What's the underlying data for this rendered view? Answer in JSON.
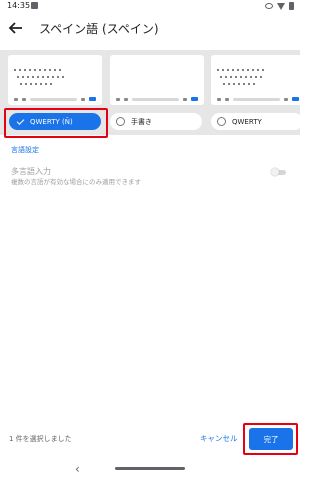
{
  "status_bar": {
    "time": "14:35",
    "icons": [
      "image-icon",
      "eye-icon",
      "wifi-icon",
      "battery-icon"
    ]
  },
  "header": {
    "back_icon": "arrow-left-icon",
    "title": "スペイン語 (スペイン)"
  },
  "layouts": [
    {
      "label": "QWERTY (Ñ)",
      "selected": true
    },
    {
      "label": "手書き",
      "selected": false
    },
    {
      "label": "QWERTY",
      "selected": false
    }
  ],
  "settings": {
    "language_settings_link": "言語設定",
    "multilingual_title": "多言語入力",
    "multilingual_desc": "複数の言語が有効な場合にのみ適用できます",
    "multilingual_enabled": false
  },
  "footer": {
    "selected_count": "1 件を選択しました",
    "cancel_label": "キャンセル",
    "done_label": "完了"
  },
  "colors": {
    "accent": "#1a73e8",
    "highlight": "#e60012"
  },
  "nav_bar": {
    "back_glyph": "‹"
  }
}
